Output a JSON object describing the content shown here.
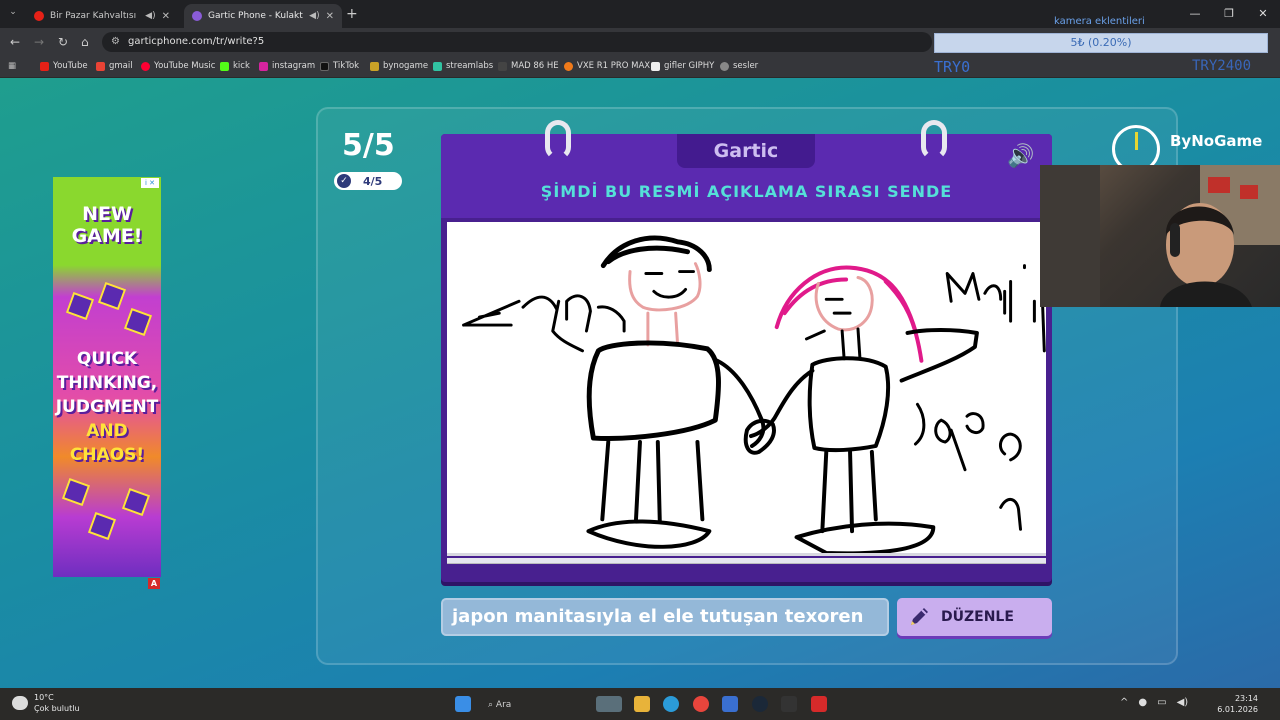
{
  "browser": {
    "tabs": [
      {
        "title": "Bir Pazar Kahvaltısı - YouTu",
        "active": false
      },
      {
        "title": "Gartic Phone - Kulaktan Kul",
        "active": true
      }
    ],
    "url": "garticphone.com/tr/write?5",
    "bookmarks": [
      "YouTube",
      "gmail",
      "YouTube Music",
      "kick",
      "instagram",
      "TikTok",
      "bynogame",
      "streamlabs",
      "MAD 86 HE",
      "VXE R1 PRO MAX",
      "gifler GIPHY",
      "sesler"
    ]
  },
  "overlay": {
    "title": "kamera eklentileri",
    "bar_text": "5₺ (0.20%)",
    "left_text": "TRY0",
    "right_text": "TRY2400"
  },
  "game": {
    "round": "5/5",
    "done_count": "4/5",
    "logo": "Gartic",
    "instruction": "ŞİMDİ BU RESMİ AÇIKLAMA SIRASI SENDE",
    "answer": "japon manitasıyla el ele tutuşan texoren",
    "edit_label": "DÜZENLE",
    "brand": "ByNoGame"
  },
  "ad": {
    "badge": "i ✕",
    "headline": "NEW GAME!",
    "line1": "QUICK THINKING,",
    "line2": "JUDGMENT",
    "line3": "AND CHAOS!",
    "corner": "A"
  },
  "taskbar": {
    "temperature": "10°C",
    "weather": "Çok bulutlu",
    "search_placeholder": "Ara",
    "time": "23:14",
    "date": "6.01.2026"
  },
  "colors": {
    "page_bg": "#1c8fa4",
    "book": "#48208f",
    "instruction": "#55e0d8",
    "button": "#c9aeee"
  }
}
